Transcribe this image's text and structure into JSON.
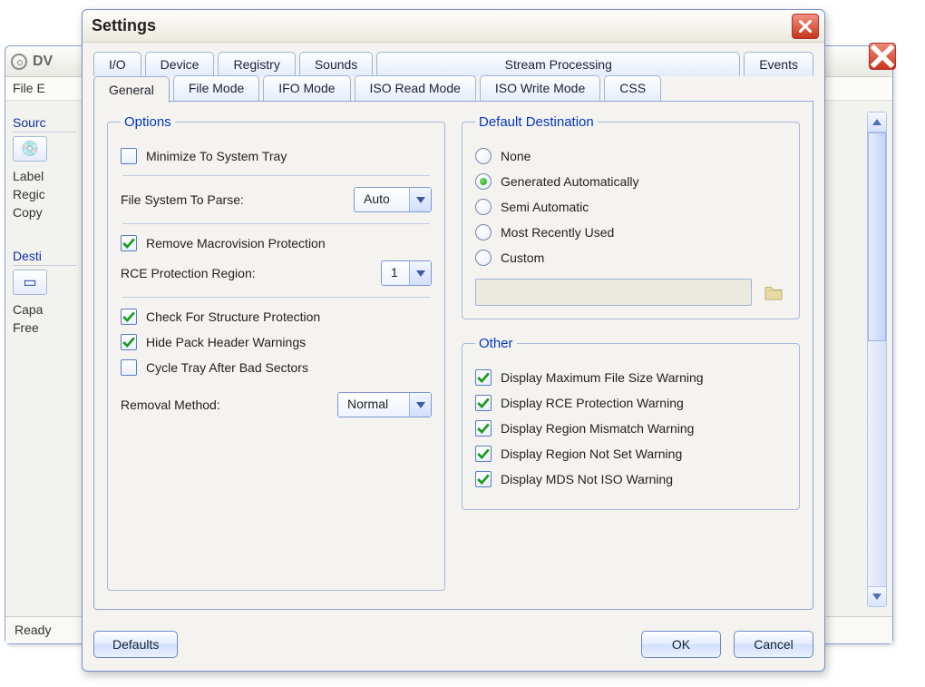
{
  "bg": {
    "title_fragment": "DV",
    "menu_fragment": "File   E",
    "side": {
      "source_heading": "Sourc",
      "labels": [
        "Label",
        "Regic",
        "Copy"
      ],
      "dest_heading": "Desti",
      "dest_labels": [
        "Capa",
        "Free"
      ]
    },
    "status": "Ready"
  },
  "dialog": {
    "title": "Settings",
    "tabs_row1": [
      "I/O",
      "Device",
      "Registry",
      "Sounds",
      "Stream Processing",
      "Events"
    ],
    "tabs_row2": [
      "General",
      "File Mode",
      "IFO Mode",
      "ISO Read Mode",
      "ISO Write Mode",
      "CSS"
    ],
    "active_tab": "General",
    "buttons": {
      "defaults": "Defaults",
      "ok": "OK",
      "cancel": "Cancel"
    }
  },
  "options": {
    "legend": "Options",
    "minimize_tray": {
      "label": "Minimize To System Tray",
      "checked": false
    },
    "fs_parse_label": "File System To Parse:",
    "fs_parse_value": "Auto",
    "remove_macro": {
      "label": "Remove Macrovision Protection",
      "checked": true
    },
    "rce_label": "RCE Protection Region:",
    "rce_value": "1",
    "chk_struct": {
      "label": "Check For Structure Protection",
      "checked": true
    },
    "hide_pack": {
      "label": "Hide Pack Header Warnings",
      "checked": true
    },
    "cycle_tray": {
      "label": "Cycle Tray After Bad Sectors",
      "checked": false
    },
    "removal_label": "Removal Method:",
    "removal_value": "Normal"
  },
  "destination": {
    "legend": "Default Destination",
    "items": [
      {
        "label": "None",
        "on": false
      },
      {
        "label": "Generated Automatically",
        "on": true
      },
      {
        "label": "Semi Automatic",
        "on": false
      },
      {
        "label": "Most Recently Used",
        "on": false
      },
      {
        "label": "Custom",
        "on": false
      }
    ],
    "path": ""
  },
  "other": {
    "legend": "Other",
    "items": [
      {
        "label": "Display Maximum File Size Warning",
        "checked": true
      },
      {
        "label": "Display RCE Protection Warning",
        "checked": true
      },
      {
        "label": "Display Region Mismatch Warning",
        "checked": true
      },
      {
        "label": "Display Region Not Set Warning",
        "checked": true
      },
      {
        "label": "Display MDS Not ISO Warning",
        "checked": true
      }
    ]
  }
}
